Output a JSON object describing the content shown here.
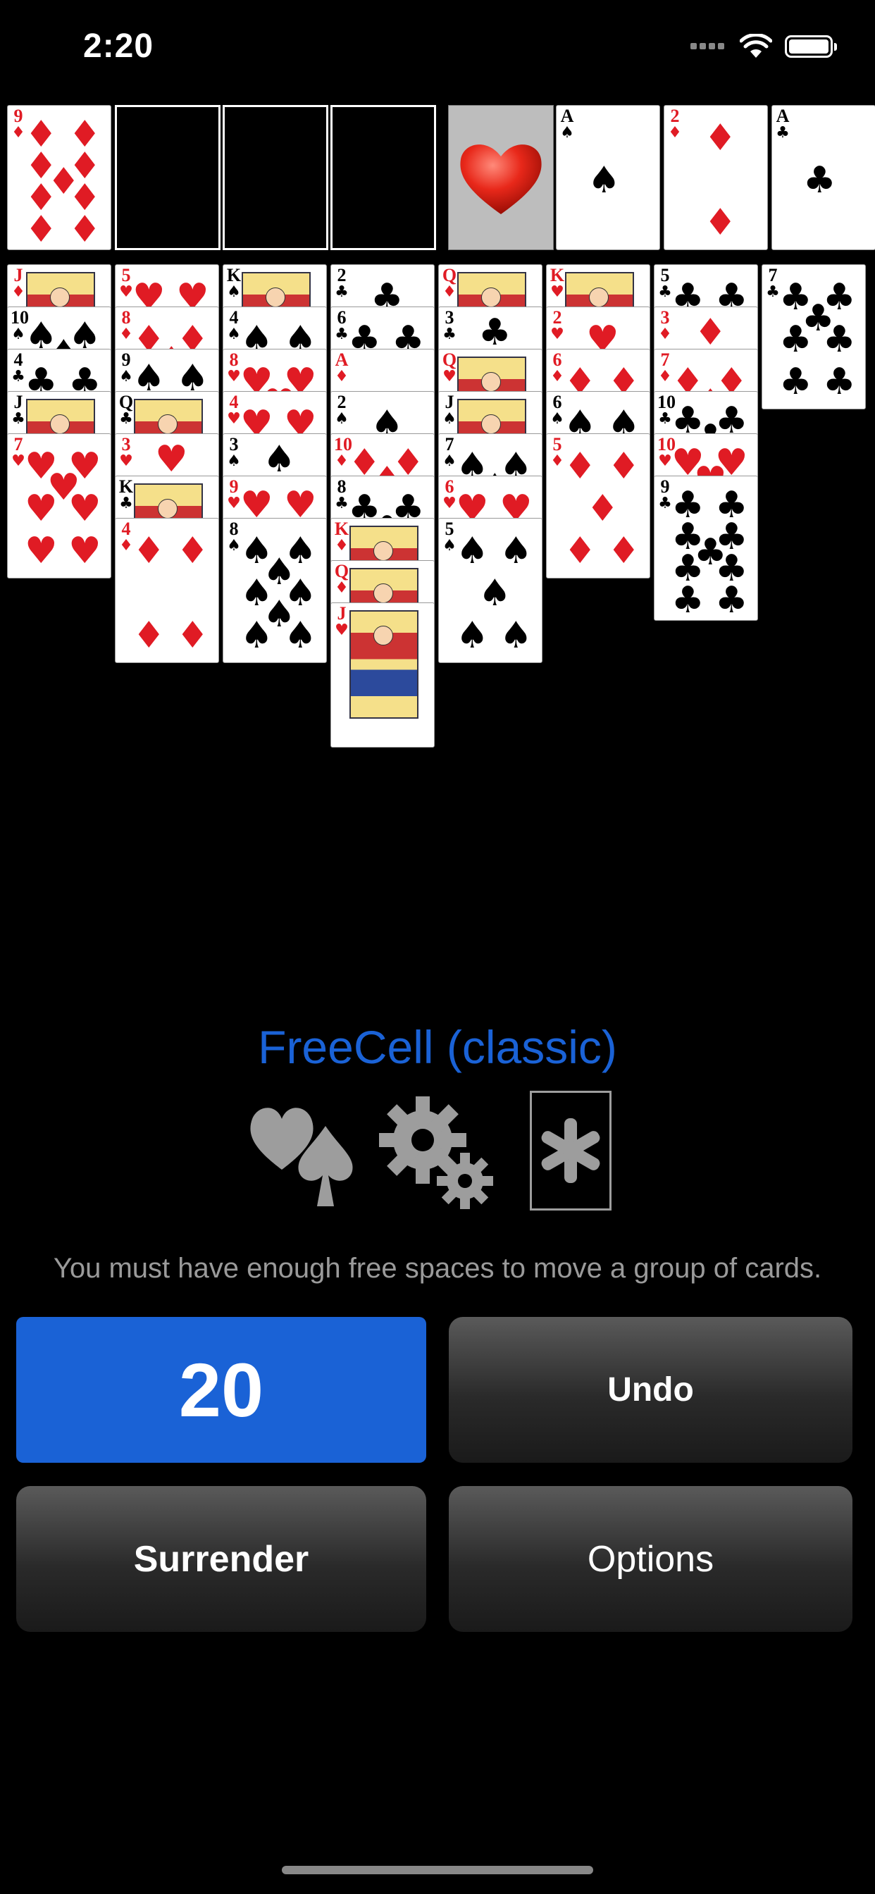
{
  "status_bar": {
    "time": "2:20"
  },
  "game": {
    "title": "FreeCell (classic)",
    "hint": "You must have enough free spaces to move a group of cards.",
    "free_cells": [
      {
        "rank": "9",
        "suit": "♦"
      },
      null,
      null,
      null
    ],
    "foundations": [
      {
        "empty_icon": "heart-icon"
      },
      {
        "rank": "A",
        "suit": "♠"
      },
      {
        "rank": "2",
        "suit": "♦"
      },
      {
        "rank": "A",
        "suit": "♣"
      }
    ],
    "tableau": [
      [
        {
          "rank": "J",
          "suit": "♦"
        },
        {
          "rank": "10",
          "suit": "♠"
        },
        {
          "rank": "4",
          "suit": "♣"
        },
        {
          "rank": "J",
          "suit": "♣"
        },
        {
          "rank": "7",
          "suit": "♥"
        }
      ],
      [
        {
          "rank": "5",
          "suit": "♥"
        },
        {
          "rank": "8",
          "suit": "♦"
        },
        {
          "rank": "9",
          "suit": "♠"
        },
        {
          "rank": "Q",
          "suit": "♣"
        },
        {
          "rank": "3",
          "suit": "♥"
        },
        {
          "rank": "K",
          "suit": "♣"
        },
        {
          "rank": "4",
          "suit": "♦"
        }
      ],
      [
        {
          "rank": "K",
          "suit": "♠"
        },
        {
          "rank": "4",
          "suit": "♠"
        },
        {
          "rank": "8",
          "suit": "♥"
        },
        {
          "rank": "4",
          "suit": "♥"
        },
        {
          "rank": "3",
          "suit": "♠"
        },
        {
          "rank": "9",
          "suit": "♥"
        },
        {
          "rank": "8",
          "suit": "♠"
        }
      ],
      [
        {
          "rank": "2",
          "suit": "♣"
        },
        {
          "rank": "6",
          "suit": "♣"
        },
        {
          "rank": "A",
          "suit": "♦"
        },
        {
          "rank": "2",
          "suit": "♠"
        },
        {
          "rank": "10",
          "suit": "♦"
        },
        {
          "rank": "8",
          "suit": "♣"
        },
        {
          "rank": "K",
          "suit": "♦"
        },
        {
          "rank": "Q",
          "suit": "♦"
        },
        {
          "rank": "J",
          "suit": "♥"
        }
      ],
      [
        {
          "rank": "Q",
          "suit": "♦"
        },
        {
          "rank": "3",
          "suit": "♣"
        },
        {
          "rank": "Q",
          "suit": "♥"
        },
        {
          "rank": "J",
          "suit": "♠"
        },
        {
          "rank": "7",
          "suit": "♠"
        },
        {
          "rank": "6",
          "suit": "♥"
        },
        {
          "rank": "5",
          "suit": "♠"
        }
      ],
      [
        {
          "rank": "K",
          "suit": "♥"
        },
        {
          "rank": "2",
          "suit": "♥"
        },
        {
          "rank": "6",
          "suit": "♦"
        },
        {
          "rank": "6",
          "suit": "♠"
        },
        {
          "rank": "5",
          "suit": "♦"
        }
      ],
      [
        {
          "rank": "5",
          "suit": "♣"
        },
        {
          "rank": "3",
          "suit": "♦"
        },
        {
          "rank": "7",
          "suit": "♦"
        },
        {
          "rank": "10",
          "suit": "♣"
        },
        {
          "rank": "10",
          "suit": "♥"
        },
        {
          "rank": "9",
          "suit": "♣"
        }
      ],
      [
        {
          "rank": "7",
          "suit": "♣"
        }
      ]
    ]
  },
  "toolbar_icons": [
    "suits-icon",
    "settings-gears-icon",
    "asterisk-card-icon"
  ],
  "buttons": {
    "moves": "20",
    "undo": "Undo",
    "surrender": "Surrender",
    "options": "Options"
  },
  "colors": {
    "accent": "#1a62d6",
    "red_suit": "#e01b24",
    "background": "#000000"
  }
}
